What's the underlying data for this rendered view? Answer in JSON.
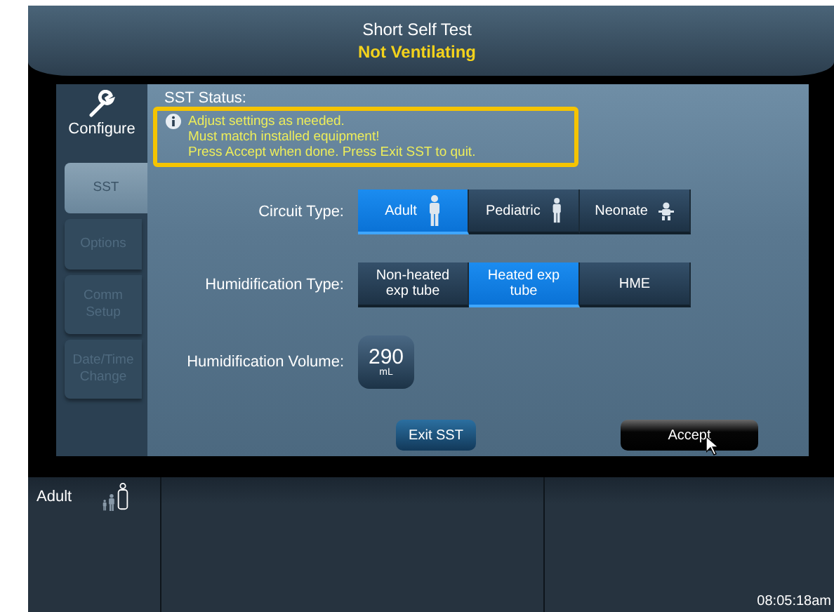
{
  "header": {
    "title": "Short Self Test",
    "status": "Not Ventilating"
  },
  "sidebar": {
    "heading": "Configure",
    "tabs": [
      {
        "label": "SST",
        "selected": true,
        "disabled": false
      },
      {
        "label": "Options",
        "selected": false,
        "disabled": true
      },
      {
        "label": "Comm Setup",
        "selected": false,
        "disabled": true
      },
      {
        "label": "Date/Time Change",
        "selected": false,
        "disabled": true
      }
    ]
  },
  "status": {
    "label": "SST Status:",
    "highlighted": true,
    "lines": [
      "Adjust settings as needed.",
      "Must match installed equipment!",
      "Press Accept when done. Press Exit SST to quit."
    ]
  },
  "settings": [
    {
      "kind": "segmented",
      "label": "Circuit Type:",
      "options": [
        {
          "label": "Adult",
          "selected": true,
          "kind": "adult"
        },
        {
          "label": "Pediatric",
          "selected": false,
          "kind": "child"
        },
        {
          "label": "Neonate",
          "selected": false,
          "kind": "baby"
        }
      ]
    },
    {
      "kind": "segmented",
      "label": "Humidification Type:",
      "options": [
        {
          "label": "Non-heated exp tube",
          "selected": false
        },
        {
          "label": "Heated exp tube",
          "selected": true
        },
        {
          "label": "HME",
          "selected": false
        }
      ]
    },
    {
      "kind": "value",
      "label": "Humidification Volume:",
      "value": "290",
      "unit": "mL"
    }
  ],
  "buttons": [
    {
      "label": "Exit SST",
      "kind": "secondary"
    },
    {
      "label": "Accept",
      "kind": "primary"
    }
  ],
  "footer": {
    "patient": "Adult",
    "time": "08:05:18am"
  }
}
